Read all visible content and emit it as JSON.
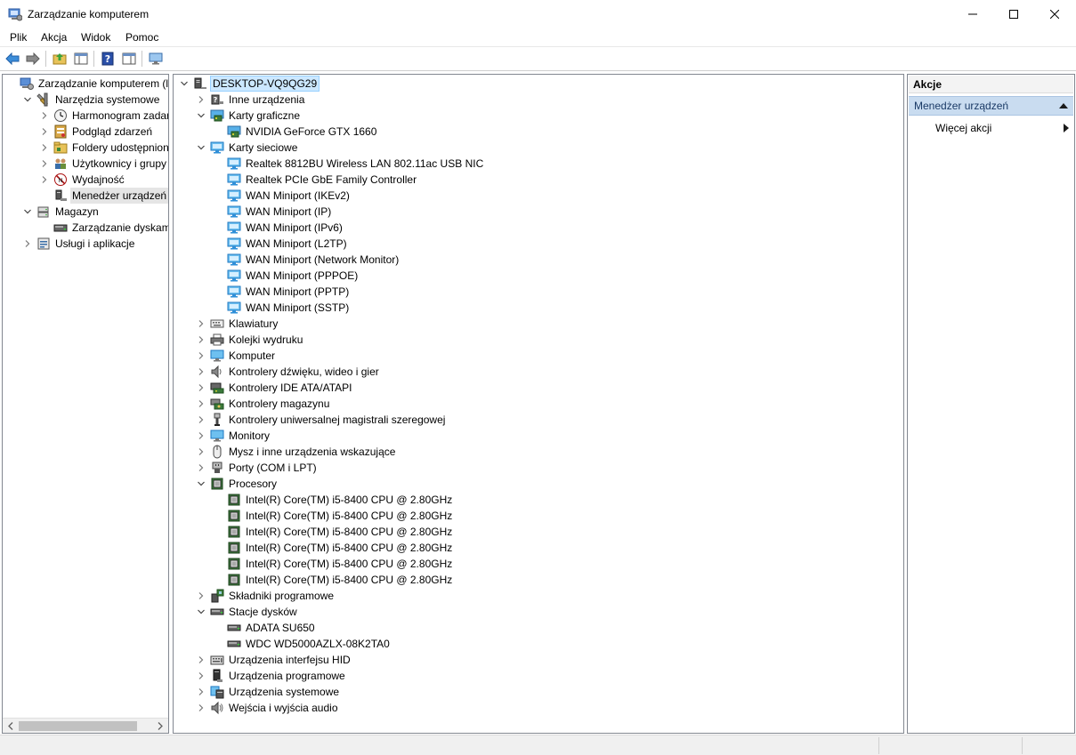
{
  "window": {
    "title": "Zarządzanie komputerem",
    "icons": {
      "app": "computer-management-icon",
      "minimize": "minimize-icon",
      "maximize": "maximize-icon",
      "close": "close-icon"
    }
  },
  "menu": [
    "Plik",
    "Akcja",
    "Widok",
    "Pomoc"
  ],
  "toolbar": {
    "buttons": [
      "back-arrow-icon",
      "forward-arrow-icon",
      "up-folder-icon",
      "show-hide-tree-icon",
      "help-icon",
      "properties-pane-icon",
      "monitor-icon"
    ]
  },
  "left_tree": {
    "items": [
      {
        "label": "Zarządzanie komputerem (loka",
        "level": 0,
        "chevron": "none",
        "icon": "computer-management-icon"
      },
      {
        "label": "Narzędzia systemowe",
        "level": 1,
        "chevron": "open",
        "icon": "tools-icon"
      },
      {
        "label": "Harmonogram zadań",
        "level": 2,
        "chevron": "closed",
        "icon": "clock-icon"
      },
      {
        "label": "Podgląd zdarzeń",
        "level": 2,
        "chevron": "closed",
        "icon": "event-viewer-icon"
      },
      {
        "label": "Foldery udostępnione",
        "level": 2,
        "chevron": "closed",
        "icon": "shared-folder-icon"
      },
      {
        "label": "Użytkownicy i grupy lok",
        "level": 2,
        "chevron": "closed",
        "icon": "users-icon"
      },
      {
        "label": "Wydajność",
        "level": 2,
        "chevron": "closed",
        "icon": "performance-icon"
      },
      {
        "label": "Menedżer urządzeń",
        "level": 2,
        "chevron": "none",
        "icon": "device-manager-icon",
        "selected": true
      },
      {
        "label": "Magazyn",
        "level": 1,
        "chevron": "open",
        "icon": "storage-icon"
      },
      {
        "label": "Zarządzanie dyskami",
        "level": 2,
        "chevron": "none",
        "icon": "disk-management-icon"
      },
      {
        "label": "Usługi i aplikacje",
        "level": 1,
        "chevron": "closed",
        "icon": "services-icon"
      }
    ]
  },
  "device_tree": {
    "root": "DESKTOP-VQ9QG29",
    "items": [
      {
        "label": "Inne urządzenia",
        "level": 1,
        "chevron": "closed",
        "icon": "unknown-device-icon"
      },
      {
        "label": "Karty graficzne",
        "level": 1,
        "chevron": "open",
        "icon": "display-adapter-icon"
      },
      {
        "label": "NVIDIA GeForce GTX 1660",
        "level": 2,
        "chevron": "none",
        "icon": "display-adapter-icon"
      },
      {
        "label": "Karty sieciowe",
        "level": 1,
        "chevron": "open",
        "icon": "network-adapter-icon"
      },
      {
        "label": "Realtek 8812BU Wireless LAN 802.11ac USB NIC",
        "level": 2,
        "chevron": "none",
        "icon": "network-adapter-icon"
      },
      {
        "label": "Realtek PCIe GbE Family Controller",
        "level": 2,
        "chevron": "none",
        "icon": "network-adapter-icon"
      },
      {
        "label": "WAN Miniport (IKEv2)",
        "level": 2,
        "chevron": "none",
        "icon": "network-adapter-icon"
      },
      {
        "label": "WAN Miniport (IP)",
        "level": 2,
        "chevron": "none",
        "icon": "network-adapter-icon"
      },
      {
        "label": "WAN Miniport (IPv6)",
        "level": 2,
        "chevron": "none",
        "icon": "network-adapter-icon"
      },
      {
        "label": "WAN Miniport (L2TP)",
        "level": 2,
        "chevron": "none",
        "icon": "network-adapter-icon"
      },
      {
        "label": "WAN Miniport (Network Monitor)",
        "level": 2,
        "chevron": "none",
        "icon": "network-adapter-icon"
      },
      {
        "label": "WAN Miniport (PPPOE)",
        "level": 2,
        "chevron": "none",
        "icon": "network-adapter-icon"
      },
      {
        "label": "WAN Miniport (PPTP)",
        "level": 2,
        "chevron": "none",
        "icon": "network-adapter-icon"
      },
      {
        "label": "WAN Miniport (SSTP)",
        "level": 2,
        "chevron": "none",
        "icon": "network-adapter-icon"
      },
      {
        "label": "Klawiatury",
        "level": 1,
        "chevron": "closed",
        "icon": "keyboard-icon"
      },
      {
        "label": "Kolejki wydruku",
        "level": 1,
        "chevron": "closed",
        "icon": "printer-icon"
      },
      {
        "label": "Komputer",
        "level": 1,
        "chevron": "closed",
        "icon": "computer-icon"
      },
      {
        "label": "Kontrolery dźwięku, wideo i gier",
        "level": 1,
        "chevron": "closed",
        "icon": "speaker-icon"
      },
      {
        "label": "Kontrolery IDE ATA/ATAPI",
        "level": 1,
        "chevron": "closed",
        "icon": "ide-controller-icon"
      },
      {
        "label": "Kontrolery magazynu",
        "level": 1,
        "chevron": "closed",
        "icon": "storage-controller-icon"
      },
      {
        "label": "Kontrolery uniwersalnej magistrali szeregowej",
        "level": 1,
        "chevron": "closed",
        "icon": "usb-icon"
      },
      {
        "label": "Monitory",
        "level": 1,
        "chevron": "closed",
        "icon": "monitor-icon"
      },
      {
        "label": "Mysz i inne urządzenia wskazujące",
        "level": 1,
        "chevron": "closed",
        "icon": "mouse-icon"
      },
      {
        "label": "Porty (COM i LPT)",
        "level": 1,
        "chevron": "closed",
        "icon": "port-icon"
      },
      {
        "label": "Procesory",
        "level": 1,
        "chevron": "open",
        "icon": "processor-icon"
      },
      {
        "label": "Intel(R) Core(TM) i5-8400 CPU @ 2.80GHz",
        "level": 2,
        "chevron": "none",
        "icon": "processor-icon"
      },
      {
        "label": "Intel(R) Core(TM) i5-8400 CPU @ 2.80GHz",
        "level": 2,
        "chevron": "none",
        "icon": "processor-icon"
      },
      {
        "label": "Intel(R) Core(TM) i5-8400 CPU @ 2.80GHz",
        "level": 2,
        "chevron": "none",
        "icon": "processor-icon"
      },
      {
        "label": "Intel(R) Core(TM) i5-8400 CPU @ 2.80GHz",
        "level": 2,
        "chevron": "none",
        "icon": "processor-icon"
      },
      {
        "label": "Intel(R) Core(TM) i5-8400 CPU @ 2.80GHz",
        "level": 2,
        "chevron": "none",
        "icon": "processor-icon"
      },
      {
        "label": "Intel(R) Core(TM) i5-8400 CPU @ 2.80GHz",
        "level": 2,
        "chevron": "none",
        "icon": "processor-icon"
      },
      {
        "label": "Składniki programowe",
        "level": 1,
        "chevron": "closed",
        "icon": "software-component-icon"
      },
      {
        "label": "Stacje dysków",
        "level": 1,
        "chevron": "open",
        "icon": "disk-drive-icon"
      },
      {
        "label": "ADATA SU650",
        "level": 2,
        "chevron": "none",
        "icon": "disk-drive-icon"
      },
      {
        "label": "WDC WD5000AZLX-08K2TA0",
        "level": 2,
        "chevron": "none",
        "icon": "disk-drive-icon"
      },
      {
        "label": "Urządzenia interfejsu HID",
        "level": 1,
        "chevron": "closed",
        "icon": "hid-icon"
      },
      {
        "label": "Urządzenia programowe",
        "level": 1,
        "chevron": "closed",
        "icon": "software-device-icon"
      },
      {
        "label": "Urządzenia systemowe",
        "level": 1,
        "chevron": "closed",
        "icon": "system-device-icon"
      },
      {
        "label": "Wejścia i wyjścia audio",
        "level": 1,
        "chevron": "closed",
        "icon": "audio-io-icon"
      }
    ]
  },
  "actions": {
    "header": "Akcje",
    "section": "Menedżer urządzeń",
    "item": "Więcej akcji"
  },
  "colors": {
    "selection": "#cce8ff",
    "actions_section": "#c9dcf0",
    "network_icon": "#2f8fd8",
    "cpu_icon": "#3f7d3f"
  }
}
